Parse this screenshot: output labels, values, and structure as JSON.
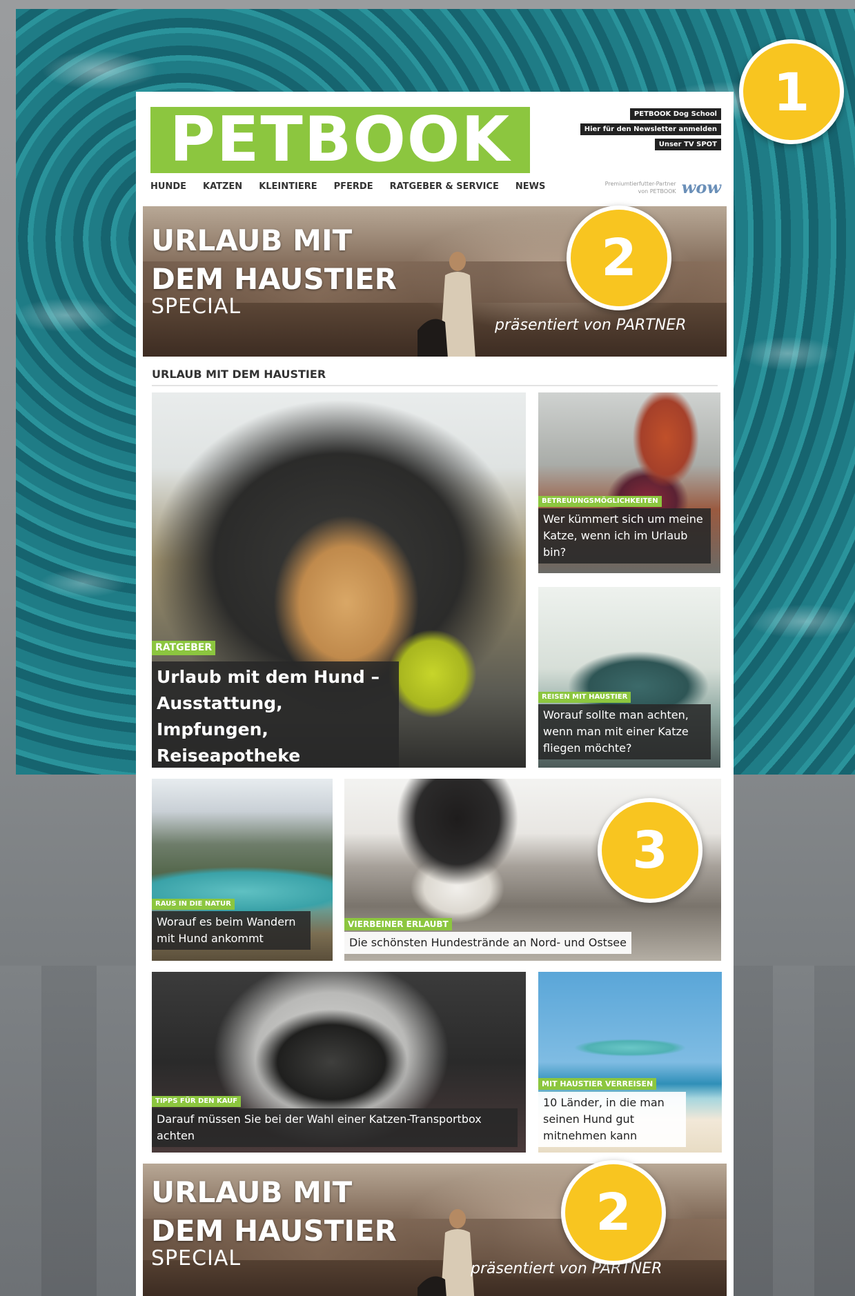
{
  "header": {
    "logo": "PETBOOK",
    "top_links": [
      "PETBOOK Dog School",
      "Hier für den Newsletter anmelden",
      "Unser TV SPOT"
    ],
    "nav": [
      "HUNDE",
      "KATZEN",
      "KLEINTIERE",
      "PFERDE",
      "RATGEBER & SERVICE",
      "NEWS"
    ],
    "partner_text": "Premiumtierfutter-Partner von PETBOOK",
    "partner_logo": "wow"
  },
  "hero": {
    "title_line1": "URLAUB MIT",
    "title_line2": "DEM HAUSTIER",
    "subtitle": "SPECIAL",
    "presented": "präsentiert von PARTNER"
  },
  "section_title": "URLAUB MIT DEM HAUSTIER",
  "articles": [
    {
      "category": "RATGEBER",
      "title": "Urlaub mit dem Hund – Ausstattung, Impfungen, Reiseapotheke"
    },
    {
      "category": "BETREUUNGSMÖGLICHKEITEN",
      "title": "Wer kümmert sich um meine Katze, wenn ich im Urlaub bin?"
    },
    {
      "category": "REISEN MIT HAUSTIER",
      "title": "Worauf sollte man achten, wenn man mit einer Katze fliegen möchte?"
    },
    {
      "category": "RAUS IN DIE NATUR",
      "title": "Worauf es beim Wandern mit Hund ankommt"
    },
    {
      "category": "VIERBEINER ERLAUBT",
      "title": "Die schönsten Hundestrände an Nord- und Ostsee"
    },
    {
      "category": "TIPPS FÜR DEN KAUF",
      "title": "Darauf müssen Sie bei der Wahl einer Katzen-Transportbox achten"
    },
    {
      "category": "MIT HAUSTIER VERREISEN",
      "title": "10 Länder, in die man seinen Hund gut mitnehmen kann"
    }
  ],
  "badges": [
    "1",
    "2",
    "3",
    "2"
  ],
  "colors": {
    "brand_green": "#8cc63f",
    "badge_yellow": "#f8c520"
  }
}
